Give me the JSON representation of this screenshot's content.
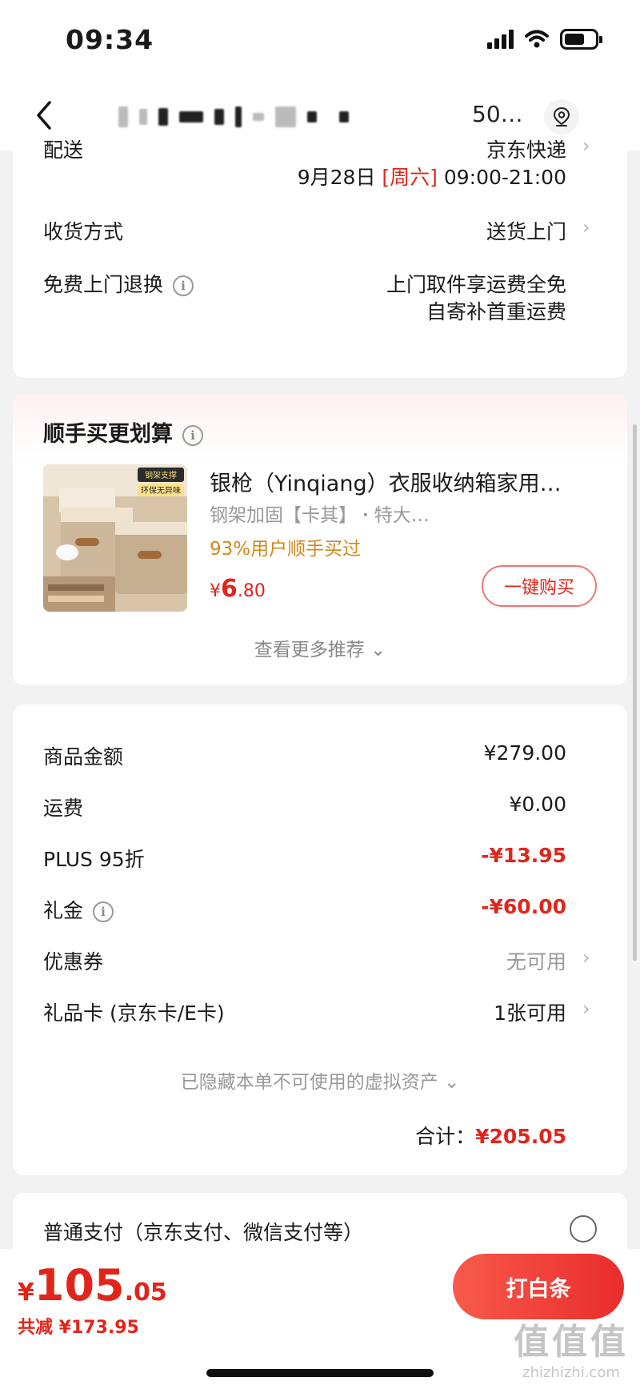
{
  "status_bar": {
    "time": "09:34"
  },
  "nav": {
    "title_tail": "50…"
  },
  "delivery": {
    "label": "配送",
    "carrier": "京东快递",
    "date": "9月28日",
    "weekday": "[周六]",
    "time_window": "09:00-21:00",
    "receive_label": "收货方式",
    "receive_value": "送货上门",
    "return_label": "免费上门退换",
    "return_line1": "上门取件享运费全免",
    "return_line2": "自寄补首重运费",
    "info_glyph": "i"
  },
  "recommend": {
    "title": "顺手买更划算",
    "product_name": "银枪（Yinqiang）衣服收纳箱家用…",
    "product_spec": "钢架加固【卡其】  ꞏ  特大…",
    "product_note": "93%用户顺手买过",
    "price_currency": "¥",
    "price_int": "6",
    "price_dec": ".80",
    "buy_label": "一键购买",
    "more_label": "查看更多推荐 ⌄",
    "thumb_tag1": "钢架支撑",
    "thumb_tag2": "环保无异味"
  },
  "amounts": {
    "rows": [
      {
        "label": "商品金额",
        "value": "¥279.00"
      },
      {
        "label": "运费",
        "value": "¥0.00"
      },
      {
        "label": "PLUS 95折",
        "value": "-¥13.95"
      },
      {
        "label": "礼金",
        "value": "-¥60.00"
      },
      {
        "label": "优惠券",
        "value": "无可用"
      },
      {
        "label": "礼品卡 (京东卡/E卡)",
        "value": "1张可用"
      }
    ],
    "hidden_note": "已隐藏本单不可使用的虚拟资产 ⌄",
    "total_label": "合计：",
    "total_value": "¥205.05"
  },
  "payment": {
    "label": "普通支付（京东支付、微信支付等）"
  },
  "bottom_bar": {
    "currency": "¥",
    "amount_int": "105",
    "amount_dec": ".05",
    "saved": "共减 ¥173.95",
    "cta": "打白条"
  },
  "watermark": {
    "logo": "值值值",
    "url": "zhizhizhi.com"
  },
  "colors": {
    "accent": "#e1251b",
    "note": "#d08a1e"
  }
}
